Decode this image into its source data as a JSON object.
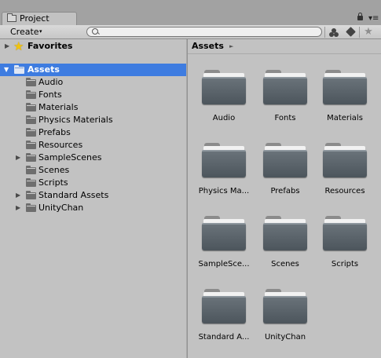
{
  "window": {
    "tab_label": "Project",
    "menu_glyph": "▾≡"
  },
  "toolbar": {
    "create_label": "Create",
    "create_arrow": "▾",
    "search_placeholder": "",
    "favorite_glyph": "★"
  },
  "tree": {
    "favorites_label": "Favorites",
    "assets_label": "Assets",
    "children": [
      "Audio",
      "Fonts",
      "Materials",
      "Physics Materials",
      "Prefabs",
      "Resources",
      "SampleScenes",
      "Scenes",
      "Scripts",
      "Standard Assets",
      "UnityChan"
    ]
  },
  "breadcrumb": {
    "label": "Assets",
    "arrow": "►"
  },
  "grid": {
    "items": [
      "Audio",
      "Fonts",
      "Materials",
      "Physics Ma...",
      "Prefabs",
      "Resources",
      "SampleSce...",
      "Scenes",
      "Scripts",
      "Standard A...",
      "UnityChan"
    ]
  },
  "icons": {
    "folder": "folder-icon",
    "fold_expanded": "▼",
    "fold_collapsed": "▶",
    "star": "★"
  },
  "colors": {
    "selection": "#3e7ce0",
    "panel": "#c2c2c2",
    "folder": "#5c656c"
  }
}
